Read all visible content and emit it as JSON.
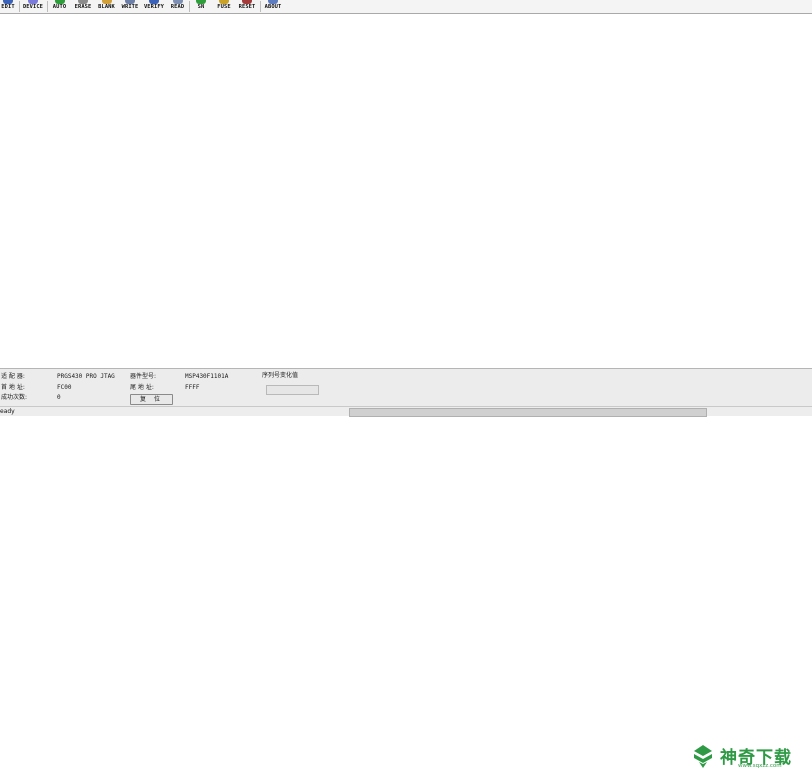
{
  "toolbar": {
    "buttons": [
      {
        "label": "EDIT",
        "icon": "edit-icon",
        "color": "#3a62b8"
      },
      {
        "label": "DEVICE",
        "icon": "device-icon",
        "color": "#7a7adb"
      },
      {
        "label": "AUTO",
        "icon": "auto-icon",
        "color": "#2e9e3b"
      },
      {
        "label": "ERASE",
        "icon": "erase-icon",
        "color": "#8c8c8c"
      },
      {
        "label": "BLANK",
        "icon": "blank-icon",
        "color": "#d2a03a"
      },
      {
        "label": "WRITE",
        "icon": "write-icon",
        "color": "#6c7fa6"
      },
      {
        "label": "VERIFY",
        "icon": "verify-icon",
        "color": "#3a62b8"
      },
      {
        "label": "READ",
        "icon": "read-icon",
        "color": "#7d8fb2"
      },
      {
        "label": "SN",
        "icon": "sn-icon",
        "color": "#2e9e3b"
      },
      {
        "label": "FUSE",
        "icon": "fuse-icon",
        "color": "#c9a227"
      },
      {
        "label": "RESET",
        "icon": "reset-icon",
        "color": "#a33b3b"
      },
      {
        "label": "ABOUT",
        "icon": "about-icon",
        "color": "#5d7bbf"
      }
    ]
  },
  "info": {
    "adapter_label": "适 配 器:",
    "adapter_value": "PRGS430 PRO JTAG",
    "start_addr_label": "首 地 址:",
    "start_addr_value": "FC00",
    "success_count_label": "成功次数:",
    "success_count_value": "0",
    "device_type_label": "器件型号:",
    "device_type_value": "MSP430F1101A",
    "end_addr_label": "尾 地 址:",
    "end_addr_value": "FFFF",
    "reset_button": "复 位",
    "serial_change_label": "序列号变化值"
  },
  "watermark": {
    "name": "神奇下载",
    "url": "www.sqxzz.com",
    "color": "#2f9a45"
  },
  "status": {
    "text": "eady"
  }
}
